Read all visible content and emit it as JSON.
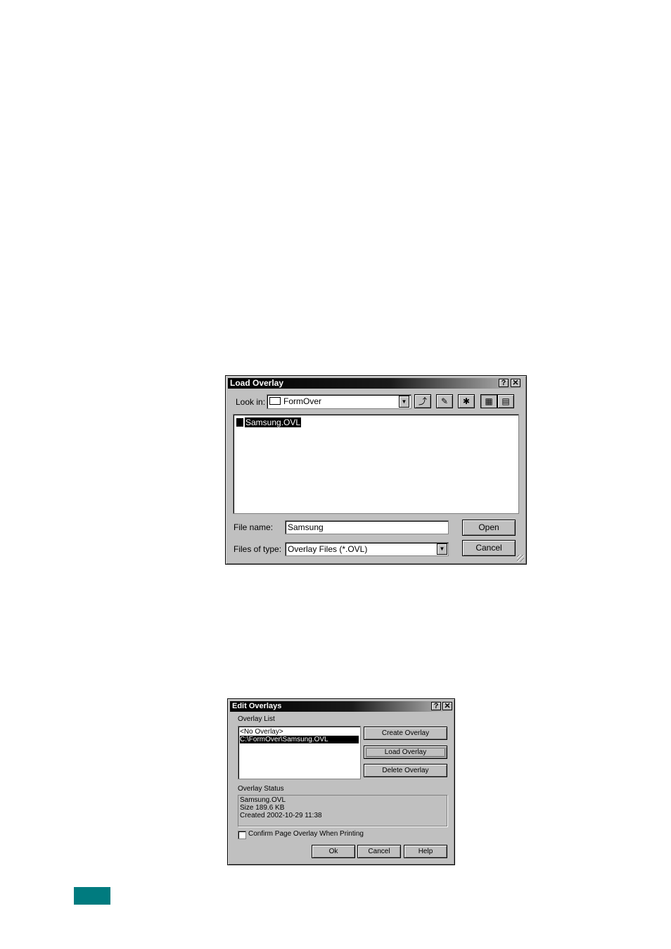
{
  "load_overlay": {
    "title": "Load Overlay",
    "help_btn": "?",
    "close_btn": "✕",
    "look_in_label": "Look in:",
    "look_in_value": "FormOver",
    "toolbar": {
      "up_icon": "up-folder-icon",
      "desktop_icon": "desktop-icon",
      "newfolder_icon": "new-folder-icon",
      "list_icon": "list-view-icon",
      "details_icon": "details-view-icon"
    },
    "files": [
      "Samsung.OVL"
    ],
    "file_name_label": "File name:",
    "file_name_value": "Samsung",
    "files_type_label": "Files of type:",
    "files_type_value": "Overlay Files (*.OVL)",
    "open_label": "Open",
    "cancel_label": "Cancel"
  },
  "edit_overlays": {
    "title": "Edit Overlays",
    "help_btn": "?",
    "close_btn": "✕",
    "overlay_list_label": "Overlay List",
    "overlay_list": [
      "<No Overlay>",
      "C:\\FormOver\\Samsung.OVL"
    ],
    "create_label": "Create Overlay",
    "load_label": "Load Overlay",
    "delete_label": "Delete Overlay",
    "status_label": "Overlay Status",
    "status_lines": [
      "Samsung.OVL",
      "Size 189.6 KB",
      "Created 2002-10-29 11:38"
    ],
    "confirm_label": "Confirm Page Overlay When Printing",
    "ok_label": "Ok",
    "cancel_label": "Cancel",
    "help_label": "Help"
  }
}
